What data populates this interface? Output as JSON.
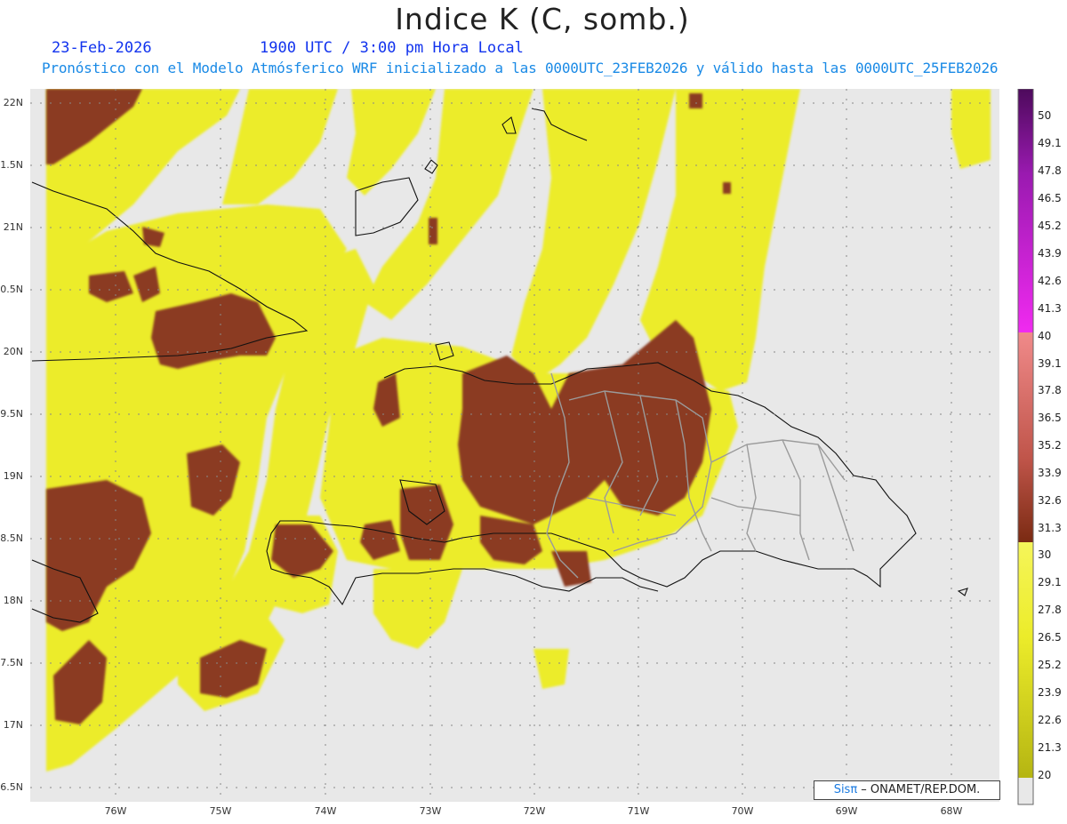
{
  "title": "Indice K (C, somb.)",
  "date": "23-Feb-2026",
  "time": "1900 UTC / 3:00 pm Hora Local",
  "description": "Pronóstico con el Modelo Atmósferico WRF inicializado a las 0000UTC_23FEB2026 y válido hasta las  0000UTC_25FEB2026",
  "lat_labels": [
    "22N",
    "1.5N",
    "21N",
    "0.5N",
    "20N",
    "9.5N",
    "19N",
    "8.5N",
    "18N",
    "7.5N",
    "17N",
    "6.5N"
  ],
  "lon_labels": [
    "76W",
    "75W",
    "74W",
    "73W",
    "72W",
    "71W",
    "70W",
    "69W",
    "68W"
  ],
  "colorbar": {
    "labels": [
      "50",
      "49.1",
      "47.8",
      "46.5",
      "45.2",
      "43.9",
      "42.6",
      "41.3",
      "40",
      "39.1",
      "37.8",
      "36.5",
      "35.2",
      "33.9",
      "32.6",
      "31.3",
      "30",
      "29.1",
      "27.8",
      "26.5",
      "25.2",
      "23.9",
      "22.6",
      "21.3",
      "20"
    ],
    "colors": {
      "above_40": "#7a1d7a",
      "range_30_40": "#b5473a",
      "range_20_30": "#e5e52a",
      "below_20": "#e8e8e8"
    }
  },
  "credit": {
    "sis": "Sisπ",
    "text": " – ONAMET/REP.DOM."
  },
  "colors": {
    "land_high": "#8b3a24",
    "yellow": "#ecec2a",
    "background": "#e8e8e8"
  }
}
